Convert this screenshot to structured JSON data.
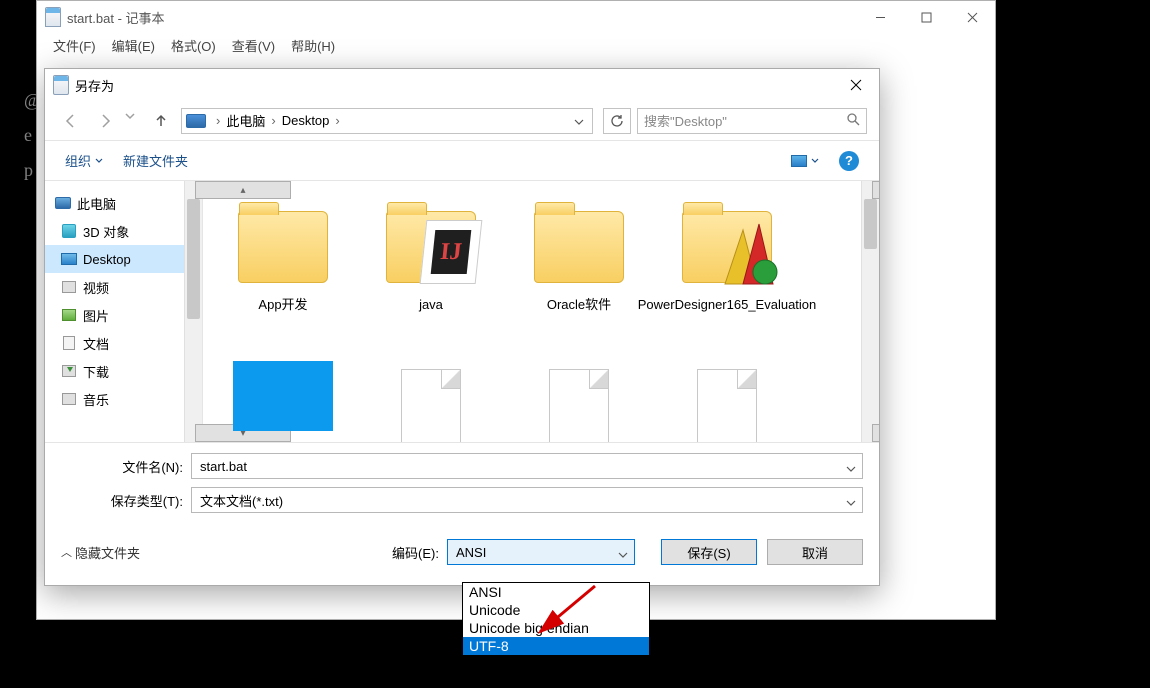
{
  "notepad": {
    "title": "start.bat - 记事本",
    "menu": [
      "文件(F)",
      "编辑(E)",
      "格式(O)",
      "查看(V)",
      "帮助(H)"
    ]
  },
  "saveas": {
    "title": "另存为",
    "breadcrumb": {
      "root_chevron": "›",
      "pc": "此电脑",
      "sep": "›",
      "desktop": "Desktop",
      "tail": "›"
    },
    "search_placeholder": "搜索\"Desktop\"",
    "toolbar": {
      "organize": "组织",
      "newfolder": "新建文件夹"
    },
    "tree": {
      "pc": "此电脑",
      "items": [
        {
          "label": "3D 对象",
          "icon": "3d"
        },
        {
          "label": "Desktop",
          "icon": "desktop",
          "selected": true
        },
        {
          "label": "视频",
          "icon": "video"
        },
        {
          "label": "图片",
          "icon": "img"
        },
        {
          "label": "文档",
          "icon": "doc"
        },
        {
          "label": "下载",
          "icon": "dl"
        },
        {
          "label": "音乐",
          "icon": "music"
        }
      ]
    },
    "files": [
      {
        "label": "App开发",
        "type": "folder"
      },
      {
        "label": "java",
        "type": "folder-java"
      },
      {
        "label": "Oracle软件",
        "type": "folder"
      },
      {
        "label": "PowerDesigner165_Evaluation",
        "type": "folder-pd"
      },
      {
        "label": "",
        "type": "blue"
      },
      {
        "label": "",
        "type": "doc"
      },
      {
        "label": "",
        "type": "doc"
      },
      {
        "label": "",
        "type": "doc"
      }
    ],
    "filename_label": "文件名(N):",
    "filename_value": "start.bat",
    "filetype_label": "保存类型(T):",
    "filetype_value": "文本文档(*.txt)",
    "hide_folders": "隐藏文件夹",
    "encoding_label": "编码(E):",
    "encoding_value": "ANSI",
    "encoding_options": [
      "ANSI",
      "Unicode",
      "Unicode big endian",
      "UTF-8"
    ],
    "save_btn": "保存(S)",
    "cancel_btn": "取消"
  }
}
